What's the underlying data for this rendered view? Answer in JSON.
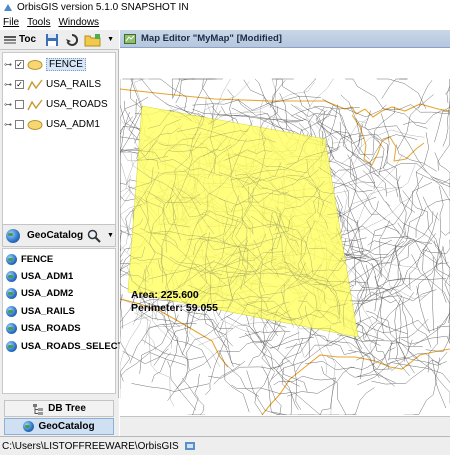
{
  "window": {
    "title": "OrbisGIS version 5.1.0 SNAPSHOT IN"
  },
  "menu": [
    {
      "label": "File"
    },
    {
      "label": "Tools"
    },
    {
      "label": "Windows"
    }
  ],
  "toc": {
    "title": "Toc",
    "layers": [
      {
        "label": "FENCE",
        "checked": true,
        "icon": "polygon-layer-icon",
        "selected": true
      },
      {
        "label": "USA_RAILS",
        "checked": true,
        "icon": "line-layer-icon",
        "selected": false
      },
      {
        "label": "USA_ROADS",
        "checked": false,
        "icon": "line-layer-icon",
        "selected": false
      },
      {
        "label": "USA_ADM1",
        "checked": false,
        "icon": "polygon-layer-icon",
        "selected": false
      }
    ]
  },
  "geocatalog": {
    "title": "GeoCatalog",
    "items": [
      {
        "label": "FENCE"
      },
      {
        "label": "USA_ADM1"
      },
      {
        "label": "USA_ADM2"
      },
      {
        "label": "USA_RAILS"
      },
      {
        "label": "USA_ROADS"
      },
      {
        "label": "USA_ROADS_SELECTION"
      }
    ]
  },
  "bottom_tabs": [
    {
      "label": "DB Tree",
      "active": false
    },
    {
      "label": "GeoCatalog",
      "active": true
    }
  ],
  "map_editor": {
    "title": "Map Editor \"MyMap\" [Modified]",
    "measure": {
      "area": "Area: 225.600",
      "perimeter": "Perimeter: 59.055"
    },
    "fence_color": "#ffff66"
  },
  "status": {
    "path": "C:\\Users\\LISTOFFREEWARE\\OrbisGIS"
  }
}
